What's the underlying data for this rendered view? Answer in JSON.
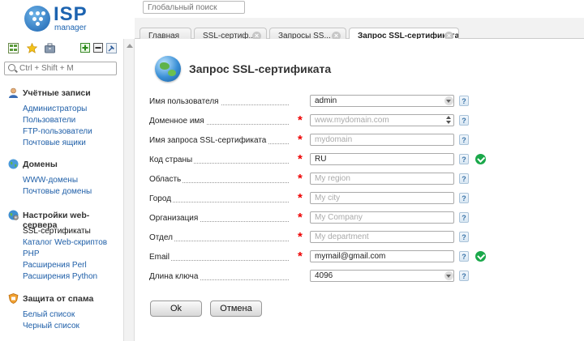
{
  "brand": {
    "logo_text": "ISP",
    "logo_sub": "manager"
  },
  "global_search": {
    "placeholder": "Глобальный поиск"
  },
  "sidebar": {
    "search_placeholder": "Ctrl + Shift + M",
    "groups": [
      {
        "title": "Учётные записи",
        "icon": "user-icon",
        "items": [
          "Администраторы",
          "Пользователи",
          "FTP-пользователи",
          "Почтовые ящики"
        ]
      },
      {
        "title": "Домены",
        "icon": "globe-icon",
        "items": [
          "WWW-домены",
          "Почтовые домены"
        ]
      },
      {
        "title": "Настройки web-сервера",
        "icon": "web-settings-icon",
        "items": [
          "SSL-сертификаты",
          "Каталог Web-скриптов",
          "PHP",
          "Расширения Perl",
          "Расширения Python"
        ],
        "active_item": "SSL-сертификаты"
      },
      {
        "title": "Защита от спама",
        "icon": "shield-icon",
        "items": [
          "Белый список",
          "Черный список"
        ]
      }
    ]
  },
  "tabs": [
    {
      "label": "Главная",
      "closable": false
    },
    {
      "label": "SSL-сертиф...",
      "closable": true
    },
    {
      "label": "Запросы SS...",
      "closable": true
    },
    {
      "label": "Запрос SSL-сертификата",
      "closable": true,
      "active": true
    }
  ],
  "form": {
    "title": "Запрос SSL-сертификата",
    "fields": {
      "username": {
        "label": "Имя пользователя",
        "value": "admin",
        "type": "select"
      },
      "domain": {
        "label": "Доменное имя",
        "placeholder": "www.mydomain.com",
        "required": true,
        "type": "spin"
      },
      "reqname": {
        "label": "Имя запроса SSL-сертификата",
        "placeholder": "mydomain",
        "required": true
      },
      "country": {
        "label": "Код страны",
        "value": "RU",
        "required": true,
        "valid": true
      },
      "region": {
        "label": "Область",
        "placeholder": "My region",
        "required": true
      },
      "city": {
        "label": "Город",
        "placeholder": "My city",
        "required": true
      },
      "org": {
        "label": "Организация",
        "placeholder": "My Company",
        "required": true
      },
      "dept": {
        "label": "Отдел",
        "placeholder": "My department",
        "required": true
      },
      "email": {
        "label": "Email",
        "value": "mymail@gmail.com",
        "required": true,
        "valid": true
      },
      "keylen": {
        "label": "Длина ключа",
        "value": "4096",
        "type": "select"
      }
    },
    "help_glyph": "?",
    "required_mark": "*",
    "ok_label": "Ok",
    "cancel_label": "Отмена"
  },
  "colors": {
    "link": "#1f5fa8",
    "accent": "#1c63b0",
    "required": "#e00000",
    "valid": "#1aa84a"
  }
}
